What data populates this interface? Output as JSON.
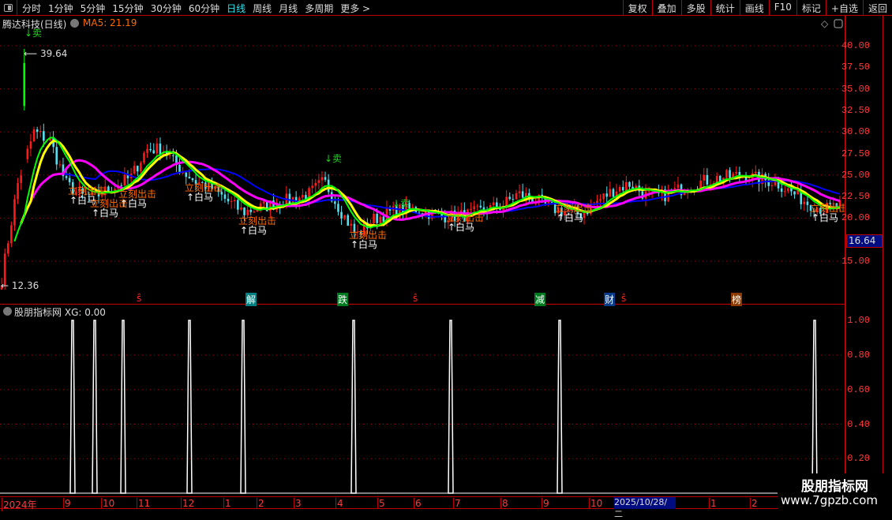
{
  "toolbar": {
    "periods": [
      "分时",
      "1分钟",
      "5分钟",
      "15分钟",
      "30分钟",
      "60分钟",
      "日线",
      "周线",
      "月线",
      "多周期",
      "更多 >"
    ],
    "active_period": "日线",
    "buttons": [
      "复权",
      "叠加",
      "多股",
      "统计",
      "画线",
      "F10",
      "标记",
      "+自选",
      "返回"
    ]
  },
  "stock": {
    "title": "腾达科技(日线)",
    "ma_label": "MA5: 21.19",
    "current_price": "16.64",
    "high_marker": "39.64",
    "low_marker": "12.36"
  },
  "price_axis": [
    "40.00",
    "37.50",
    "35.00",
    "32.50",
    "30.00",
    "27.50",
    "25.00",
    "22.50",
    "20.00",
    "15.00"
  ],
  "indicator": {
    "title": "股朋指标网",
    "value": "XG: 0.00",
    "axis": [
      "1.00",
      "0.80",
      "0.60",
      "0.40",
      "0.20"
    ]
  },
  "signals": [
    {
      "t": "ŝ",
      "c": "#ff2020",
      "bg": ""
    },
    {
      "t": "解",
      "c": "#fff",
      "bg": "#008080"
    },
    {
      "t": "跌",
      "c": "#fff",
      "bg": "#007a20"
    },
    {
      "t": "ŝ",
      "c": "#ff2020",
      "bg": ""
    },
    {
      "t": "减",
      "c": "#fff",
      "bg": "#007a20"
    },
    {
      "t": "财",
      "c": "#fff",
      "bg": "#0a3a8a"
    },
    {
      "t": "ŝ",
      "c": "#ff2020",
      "bg": ""
    },
    {
      "t": "榜",
      "c": "#fff",
      "bg": "#8a3a00"
    }
  ],
  "annotations": {
    "buy": "↑白马",
    "attack": "立刻出击",
    "sell": "↓卖"
  },
  "time_axis": [
    "2024年",
    "9",
    "10",
    "11",
    "12",
    "1",
    "2",
    "3",
    "4",
    "5",
    "6",
    "7",
    "8",
    "9",
    "10",
    "1",
    "2"
  ],
  "cursor_date": "2025/10/28/二",
  "watermark": {
    "name": "股朋指标网",
    "url": "www.7gpzb.com"
  },
  "colors": {
    "up": "#ff1a1a",
    "down": "#54e0f0",
    "ma_a": "#ffff00",
    "ma_b": "#ff00ff",
    "ma_c": "#00ff00",
    "ma_d": "#0000ff",
    "grid": "#b00000"
  },
  "chart_data": {
    "type": "candlestick",
    "closes_sampled": [
      13,
      24,
      30,
      29,
      24,
      22.5,
      22.7,
      23.7,
      24.7,
      28,
      28,
      25.8,
      24.3,
      23.5,
      22,
      20.7,
      21.2,
      21.7,
      22.2,
      22.7,
      24.3,
      21,
      18,
      19.8,
      20.6,
      21,
      21,
      20.3,
      20.2,
      20.4,
      21,
      21.4,
      22.8,
      22.3,
      21.2,
      20.8,
      20.5,
      22,
      23.3,
      24,
      22.6,
      22.6,
      23.3,
      24,
      24.5,
      24.8,
      25,
      24.5,
      24.2,
      23,
      21.8,
      21,
      21.5
    ],
    "ylim": [
      12,
      42
    ],
    "xg_signal_value": 1.0
  }
}
